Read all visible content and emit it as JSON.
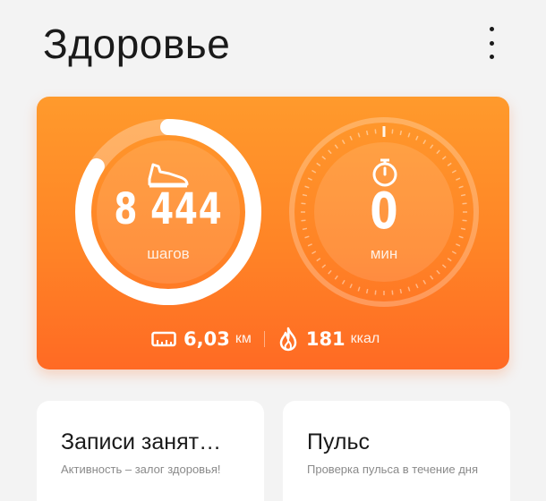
{
  "header": {
    "title": "Здоровье",
    "menu_icon": "more-vertical-icon"
  },
  "activity": {
    "steps_value": "8 444",
    "steps_unit": "шагов",
    "steps_goal_fraction": 0.84,
    "minutes_value": "0",
    "minutes_unit": "мин",
    "distance_value": "6,03",
    "distance_unit": "км",
    "calories_value": "181",
    "calories_unit": "ккал",
    "icons": [
      "shoe-icon",
      "stopwatch-icon",
      "ruler-icon",
      "flame-icon"
    ],
    "colors": {
      "gradient_top": "#ff9a2c",
      "gradient_bottom": "#ff6a24"
    }
  },
  "tiles": [
    {
      "title": "Записи занят…",
      "subtitle": "Активность – залог здоровья!"
    },
    {
      "title": "Пульс",
      "subtitle": "Проверка пульса в течение дня"
    }
  ]
}
